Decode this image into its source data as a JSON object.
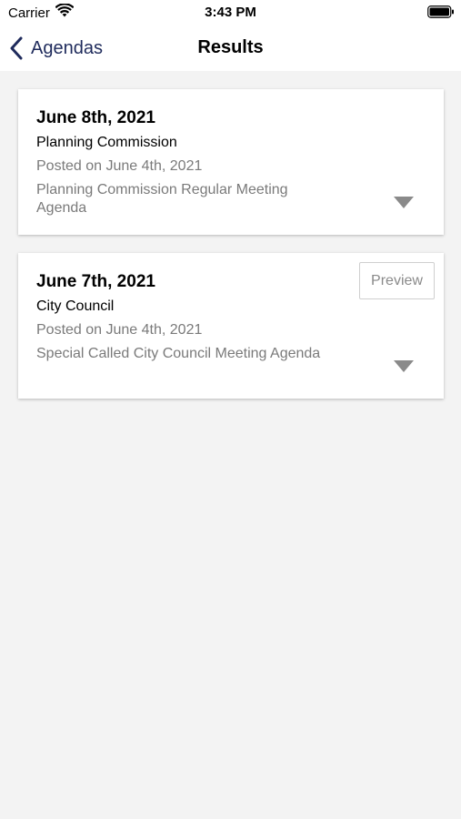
{
  "status_bar": {
    "carrier": "Carrier",
    "time": "3:43 PM",
    "icons": [
      "wifi-icon",
      "battery-icon"
    ]
  },
  "nav": {
    "back_label": "Agendas",
    "title": "Results",
    "back_icon": "chevron-left-icon",
    "accent_color": "#1f2b5c"
  },
  "results": [
    {
      "date": "June 8th, 2021",
      "body": "Planning Commission",
      "posted": "Posted on June 4th, 2021",
      "description": "Planning Commission Regular Meeting Agenda"
    },
    {
      "date": "June 7th, 2021",
      "body": "City Council",
      "posted": "Posted on June 4th, 2021",
      "description": "Special Called City Council Meeting Agenda",
      "preview_label": "Preview"
    }
  ],
  "colors": {
    "background": "#f3f3f3",
    "card": "#ffffff",
    "muted_text": "#7a7a7a",
    "caret": "#8a8a8a"
  }
}
